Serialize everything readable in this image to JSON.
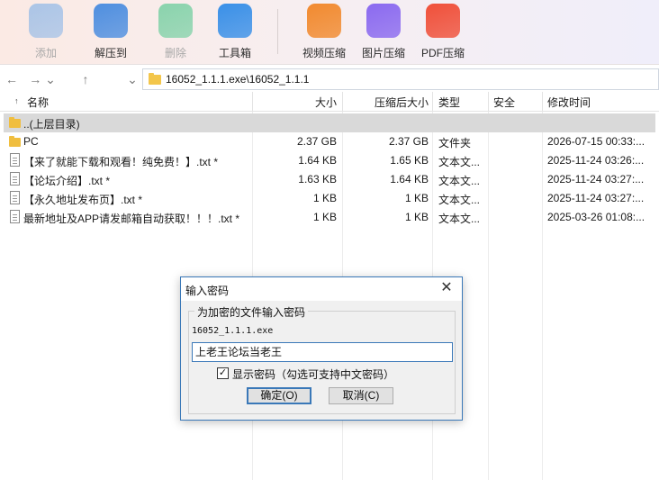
{
  "toolbar": {
    "buttons": [
      {
        "label": "添加",
        "icon": "archive-add-icon",
        "color": "#6aa6e8",
        "enabled": false
      },
      {
        "label": "解压到",
        "icon": "extract-icon",
        "color": "#4f8fe0",
        "enabled": true
      },
      {
        "label": "删除",
        "icon": "recycle-icon",
        "color": "#2fbf7a",
        "enabled": false
      },
      {
        "label": "工具箱",
        "icon": "toolbox-icon",
        "color": "#3a90e8",
        "enabled": true
      },
      {
        "label": "视频压缩",
        "icon": "video-compress-icon",
        "color": "#f28a2f",
        "enabled": true
      },
      {
        "label": "图片压缩",
        "icon": "image-compress-icon",
        "color": "#8b6af0",
        "enabled": true
      },
      {
        "label": "PDF压缩",
        "icon": "pdf-compress-icon",
        "color": "#f0503a",
        "enabled": true
      }
    ]
  },
  "address": {
    "path": "16052_1.1.1.exe\\16052_1.1.1"
  },
  "columns": {
    "name": "名称",
    "size": "大小",
    "compressed": "压缩后大小",
    "type": "类型",
    "security": "安全",
    "modified": "修改时间"
  },
  "rows": [
    {
      "kind": "parent",
      "name": "..(上层目录)",
      "size": "",
      "compressed": "",
      "type": "",
      "security": "",
      "modified": ""
    },
    {
      "kind": "folder",
      "name": "PC",
      "size": "2.37 GB",
      "compressed": "2.37 GB",
      "type": "文件夹",
      "security": "",
      "modified": "2026-07-15 00:33:..."
    },
    {
      "kind": "file",
      "name": "【来了就能下载和观看！纯免费！】.txt *",
      "size": "1.64 KB",
      "compressed": "1.65 KB",
      "type": "文本文...",
      "security": "",
      "modified": "2025-11-24 03:26:..."
    },
    {
      "kind": "file",
      "name": "【论坛介绍】.txt *",
      "size": "1.63 KB",
      "compressed": "1.64 KB",
      "type": "文本文...",
      "security": "",
      "modified": "2025-11-24 03:27:..."
    },
    {
      "kind": "file",
      "name": "【永久地址发布页】.txt *",
      "size": "1 KB",
      "compressed": "1 KB",
      "type": "文本文...",
      "security": "",
      "modified": "2025-11-24 03:27:..."
    },
    {
      "kind": "file",
      "name": "最新地址及APP请发邮箱自动获取！！！.txt *",
      "size": "1 KB",
      "compressed": "1 KB",
      "type": "文本文...",
      "security": "",
      "modified": "2025-03-26 01:08:..."
    }
  ],
  "dialog": {
    "title": "输入密码",
    "group_label": "为加密的文件输入密码",
    "filename": "16052_1.1.1.exe",
    "password_value": "上老王论坛当老王",
    "show_password_label": "显示密码（勾选可支持中文密码）",
    "show_password_checked": true,
    "ok_label": "确定(O)",
    "cancel_label": "取消(C)"
  }
}
